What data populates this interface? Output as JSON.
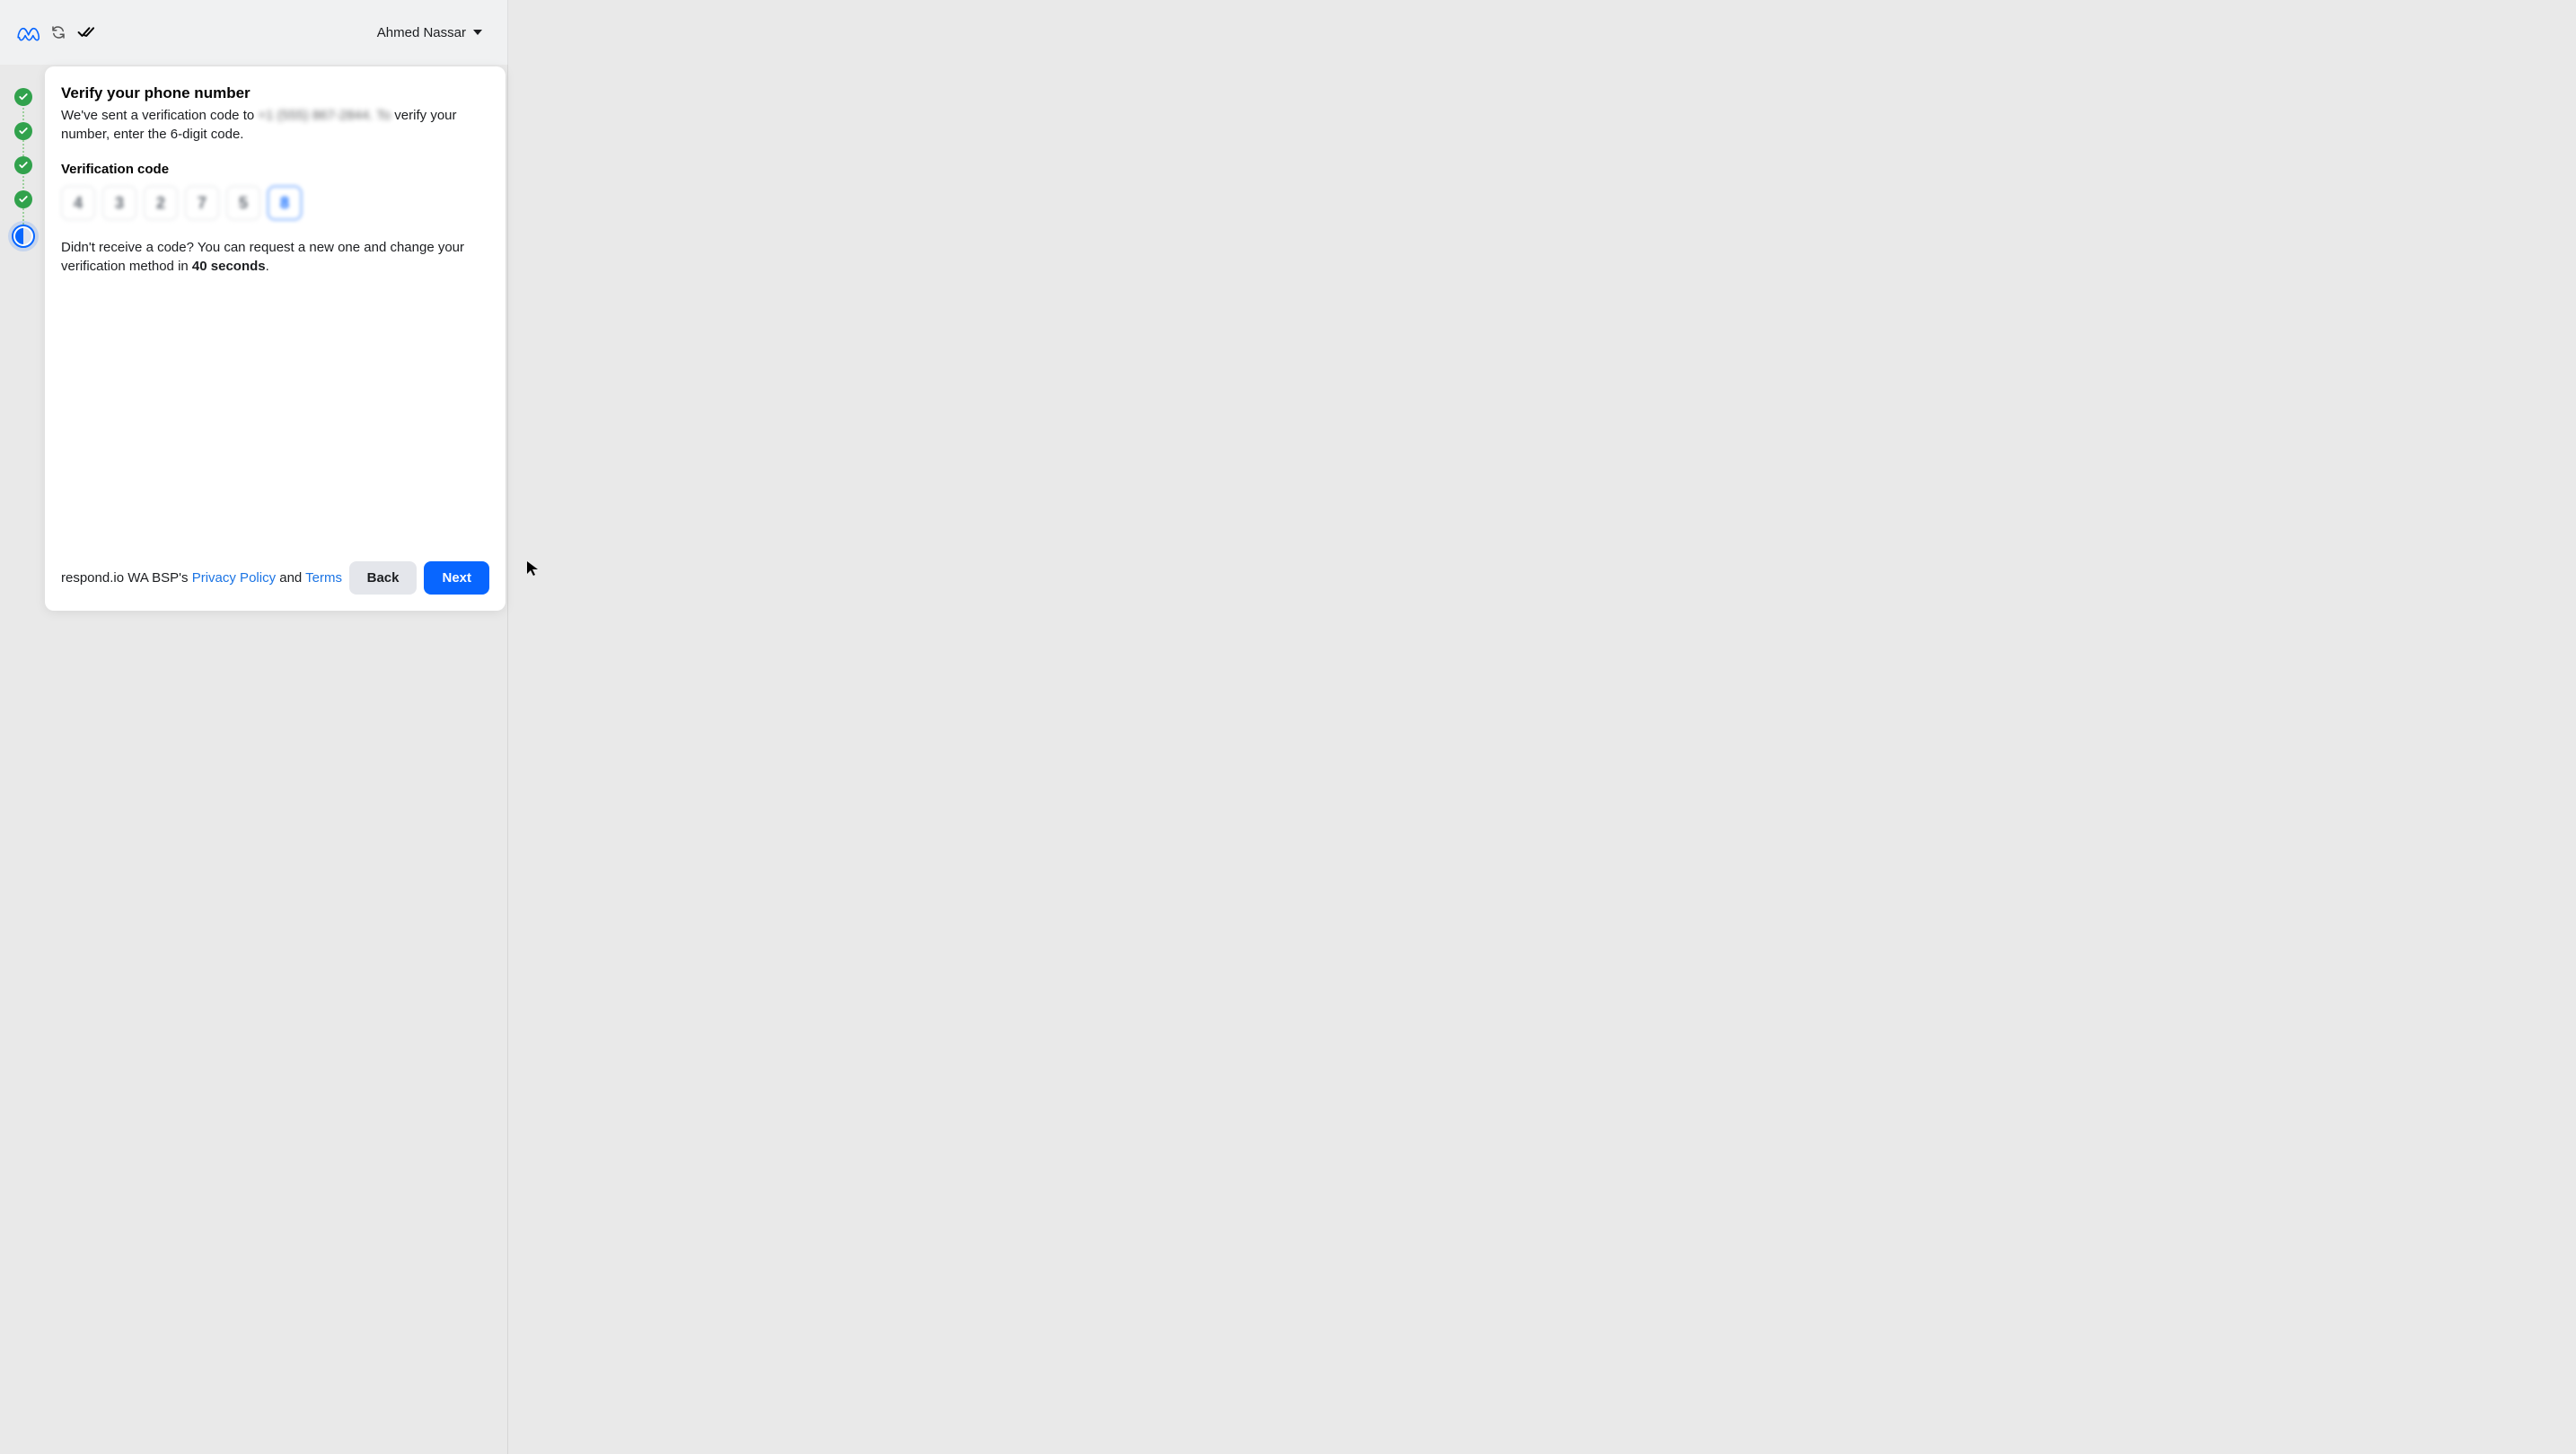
{
  "header": {
    "account_name": "Ahmed Nassar"
  },
  "steps": {
    "total": 5,
    "completed": 4,
    "current_index": 4
  },
  "card": {
    "title": "Verify your phone number",
    "subtitle_prefix": "We've sent a verification code to ",
    "subtitle_masked": "+1 (555) 867-2844. To",
    "subtitle_suffix": " verify your number, enter the 6-digit code.",
    "field_label": "Verification code",
    "code_values": [
      "4",
      "3",
      "2",
      "7",
      "5",
      "8"
    ],
    "resend_prefix": "Didn't receive a code? You can request a new one and change your verification method in ",
    "resend_countdown": "40 seconds",
    "resend_suffix": "."
  },
  "footer": {
    "legal_prefix": "respond.io WA BSP's ",
    "privacy_label": "Privacy Policy",
    "legal_mid": " and ",
    "terms_label": "Terms",
    "back_label": "Back",
    "next_label": "Next"
  }
}
